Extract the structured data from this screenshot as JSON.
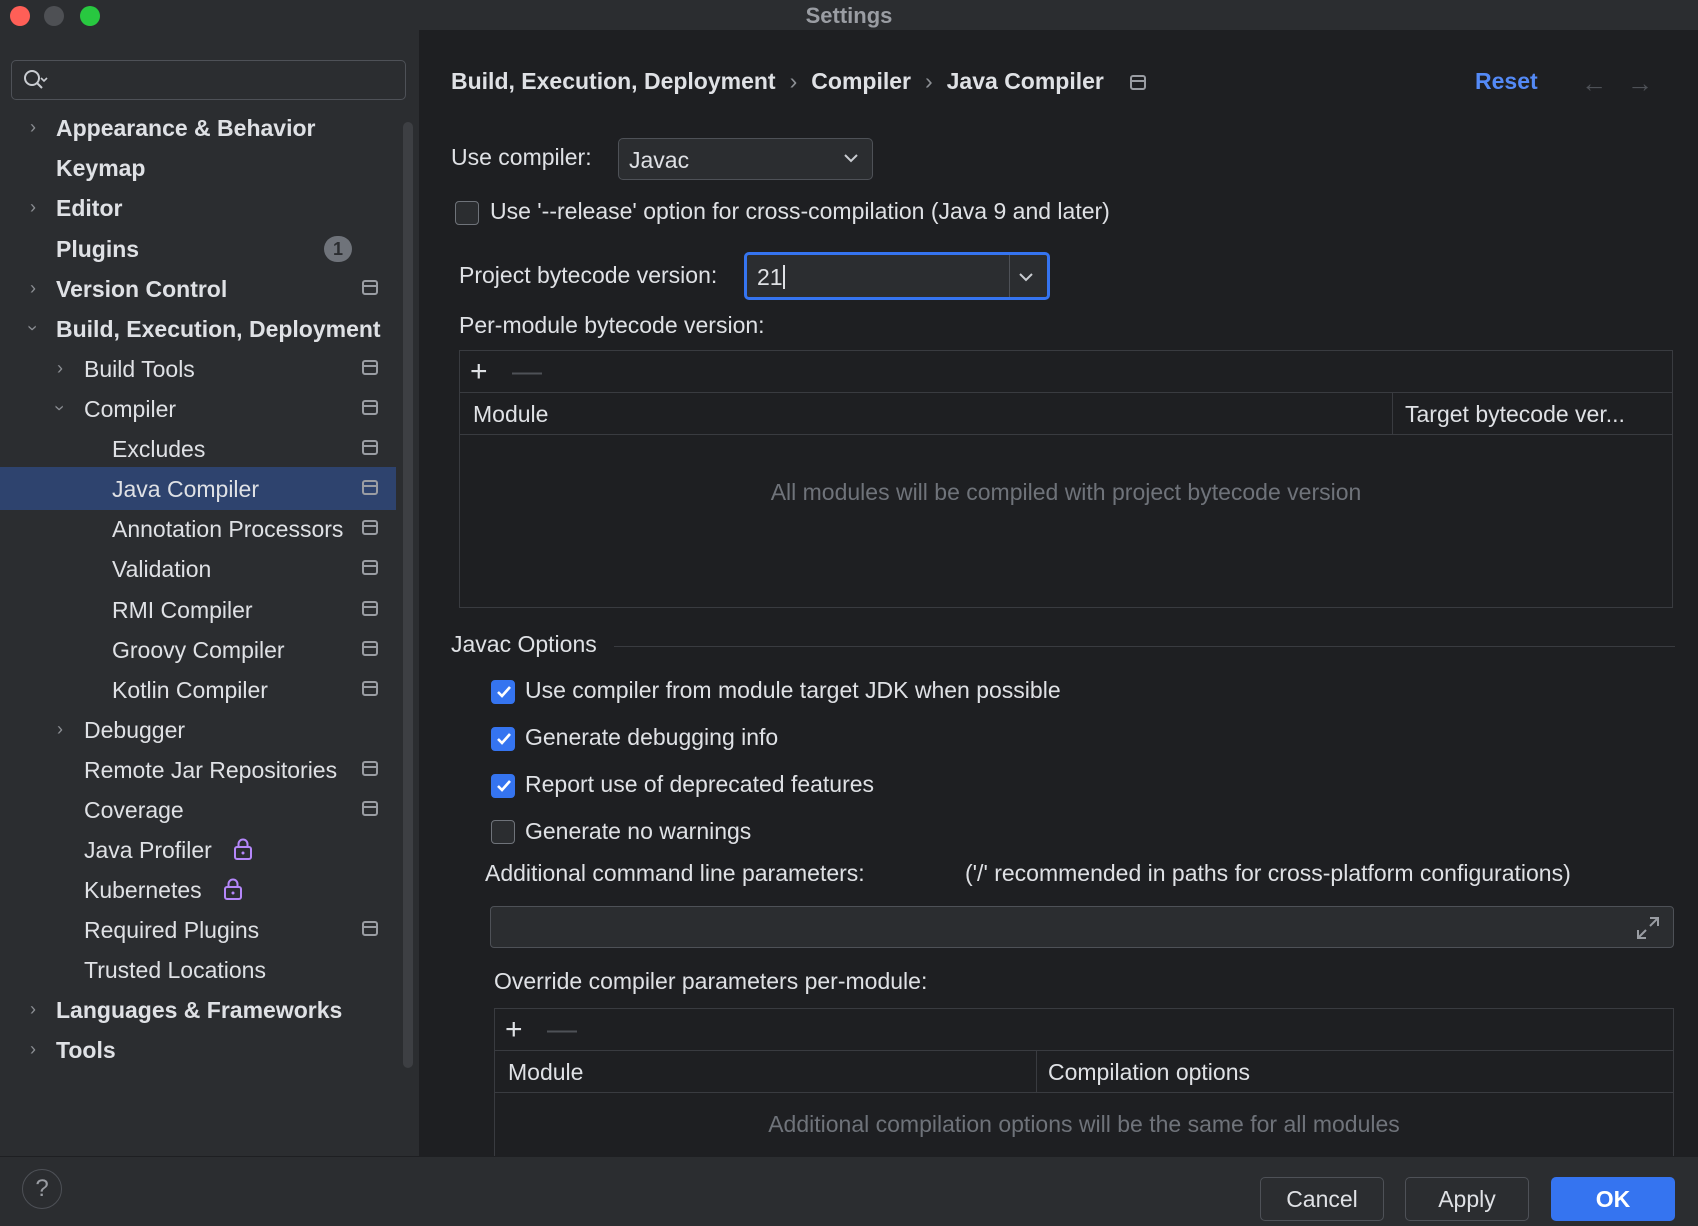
{
  "window": {
    "title": "Settings"
  },
  "search": {
    "placeholder": ""
  },
  "sidebar": {
    "items": [
      {
        "label": "Appearance & Behavior"
      },
      {
        "label": "Keymap"
      },
      {
        "label": "Editor"
      },
      {
        "label": "Plugins",
        "badge": "1"
      },
      {
        "label": "Version Control"
      },
      {
        "label": "Build, Execution, Deployment"
      },
      {
        "label": "Build Tools"
      },
      {
        "label": "Compiler"
      },
      {
        "label": "Excludes"
      },
      {
        "label": "Java Compiler"
      },
      {
        "label": "Annotation Processors"
      },
      {
        "label": "Validation"
      },
      {
        "label": "RMI Compiler"
      },
      {
        "label": "Groovy Compiler"
      },
      {
        "label": "Kotlin Compiler"
      },
      {
        "label": "Debugger"
      },
      {
        "label": "Remote Jar Repositories"
      },
      {
        "label": "Coverage"
      },
      {
        "label": "Java Profiler"
      },
      {
        "label": "Kubernetes"
      },
      {
        "label": "Required Plugins"
      },
      {
        "label": "Trusted Locations"
      },
      {
        "label": "Languages & Frameworks"
      },
      {
        "label": "Tools"
      }
    ]
  },
  "breadcrumb": {
    "parts": [
      "Build, Execution, Deployment",
      "Compiler",
      "Java Compiler"
    ],
    "separator": "›"
  },
  "header": {
    "reset": "Reset",
    "back": "←",
    "forward": "→"
  },
  "compiler": {
    "use_label": "Use compiler:",
    "use_value": "Javac",
    "release_option": {
      "label": "Use '--release' option for cross-compilation (Java 9 and later)",
      "checked": false
    },
    "bytecode_label": "Project bytecode version:",
    "bytecode_value": "21",
    "per_module_label": "Per-module bytecode version:",
    "per_module_table": {
      "columns": [
        "Module",
        "Target bytecode ver..."
      ],
      "empty": "All modules will be compiled with project bytecode version"
    }
  },
  "javac": {
    "title": "Javac Options",
    "options": [
      {
        "label": "Use compiler from module target JDK when possible",
        "checked": true
      },
      {
        "label": "Generate debugging info",
        "checked": true
      },
      {
        "label": "Report use of deprecated features",
        "checked": true
      },
      {
        "label": "Generate no warnings",
        "checked": false
      }
    ],
    "cmdline_label": "Additional command line parameters:",
    "cmdline_hint": "('/' recommended in paths for cross-platform configurations)",
    "cmdline_value": "",
    "override_label": "Override compiler parameters per-module:",
    "override_table": {
      "columns": [
        "Module",
        "Compilation options"
      ],
      "empty": "Additional compilation options will be the same for all modules"
    }
  },
  "table_toolbar": {
    "add": "+",
    "remove": "—"
  },
  "footer": {
    "help": "?",
    "cancel": "Cancel",
    "apply": "Apply",
    "ok": "OK"
  },
  "colors": {
    "accent": "#3574f0",
    "link": "#548af7",
    "selection": "#2e436e",
    "background": "#1e1f22",
    "panel": "#2b2d30"
  }
}
